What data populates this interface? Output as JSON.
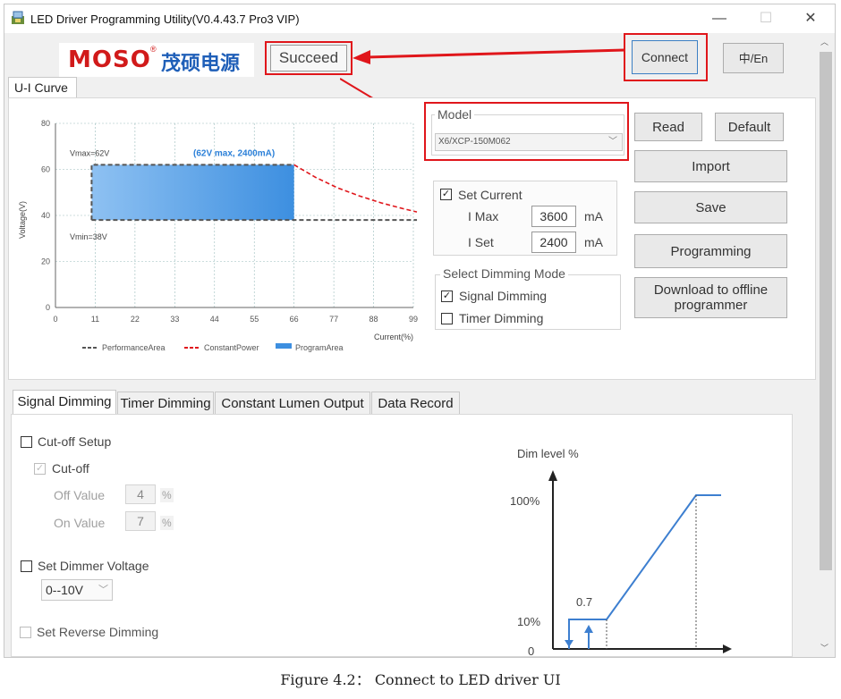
{
  "window": {
    "title": "LED Driver Programming Utility(V0.4.43.7 Pro3 VIP)",
    "icon": "app-icon",
    "controls": [
      "—",
      "☐",
      "✕"
    ]
  },
  "header": {
    "logo_en": "MOSO",
    "logo_reg": "®",
    "logo_cn": "茂硕电源",
    "status": "Succeed",
    "connect_label": "Connect",
    "lang_label": "中/En"
  },
  "top_tab": {
    "label": "U-I Curve"
  },
  "chart_data": {
    "type": "area",
    "xlabel": "Current(%)",
    "ylabel": "Voltage(V)",
    "xlim": [
      0,
      99
    ],
    "ylim": [
      0,
      80
    ],
    "x_ticks": [
      0,
      11,
      22,
      33,
      44,
      55,
      66,
      77,
      88,
      99
    ],
    "y_ticks": [
      0,
      20,
      40,
      60,
      80
    ],
    "grid": true,
    "annotations": {
      "vmax": "Vmax=62V",
      "vmin": "Vmin=38V",
      "program": "(62V max, 2400mA)"
    },
    "series": [
      {
        "name": "PerformanceArea",
        "color": "#555555",
        "style": "dashed",
        "x": [
          10,
          66,
          100
        ],
        "y": [
          38,
          38,
          38
        ]
      },
      {
        "name": "ConstantPower",
        "color": "#e0161b",
        "style": "dashed",
        "x": [
          66,
          72,
          78,
          84,
          90,
          96,
          100
        ],
        "y": [
          62,
          56.5,
          52,
          48.5,
          45.5,
          43,
          41.5
        ]
      },
      {
        "name": "ProgramArea",
        "color": "#3d8fe0",
        "style": "fill",
        "x": [
          10,
          66
        ],
        "y": [
          38,
          62
        ]
      }
    ],
    "legend": [
      "PerformanceArea",
      "ConstantPower",
      "ProgramArea"
    ],
    "legend_position": "bottom"
  },
  "model": {
    "title": "Model",
    "value": "X6/XCP-150M062"
  },
  "set_current": {
    "title": "Set Current",
    "checked": true,
    "imax_label": "I Max",
    "imax_value": "3600",
    "iset_label": "I Set",
    "iset_value": "2400",
    "unit": "mA"
  },
  "dimming_mode": {
    "title": "Select Dimming Mode",
    "signal_label": "Signal Dimming",
    "signal_checked": true,
    "timer_label": "Timer Dimming",
    "timer_checked": false
  },
  "buttons": {
    "read": "Read",
    "default": "Default",
    "import": "Import",
    "save": "Save",
    "programming": "Programming",
    "download": "Download to offline programmer"
  },
  "bottom_tabs": [
    "Signal Dimming",
    "Timer Dimming",
    "Constant Lumen Output",
    "Data Record"
  ],
  "signal": {
    "cutoff_setup": "Cut-off Setup",
    "cutoff": "Cut-off",
    "off_label": "Off Value",
    "off_value": "4",
    "on_label": "On Value",
    "on_value": "7",
    "pct": "%",
    "dimmer_voltage": "Set Dimmer Voltage",
    "dimmer_range": "0--10V",
    "reverse": "Set Reverse Dimming"
  },
  "dim_graph": {
    "title": "Dim level %",
    "y100": "100%",
    "y10": "10%",
    "y0": "0",
    "x_marker": "0.7",
    "line_color": "#3d7fd0"
  },
  "caption": "Figure 4.2：  Connect to LED driver UI"
}
